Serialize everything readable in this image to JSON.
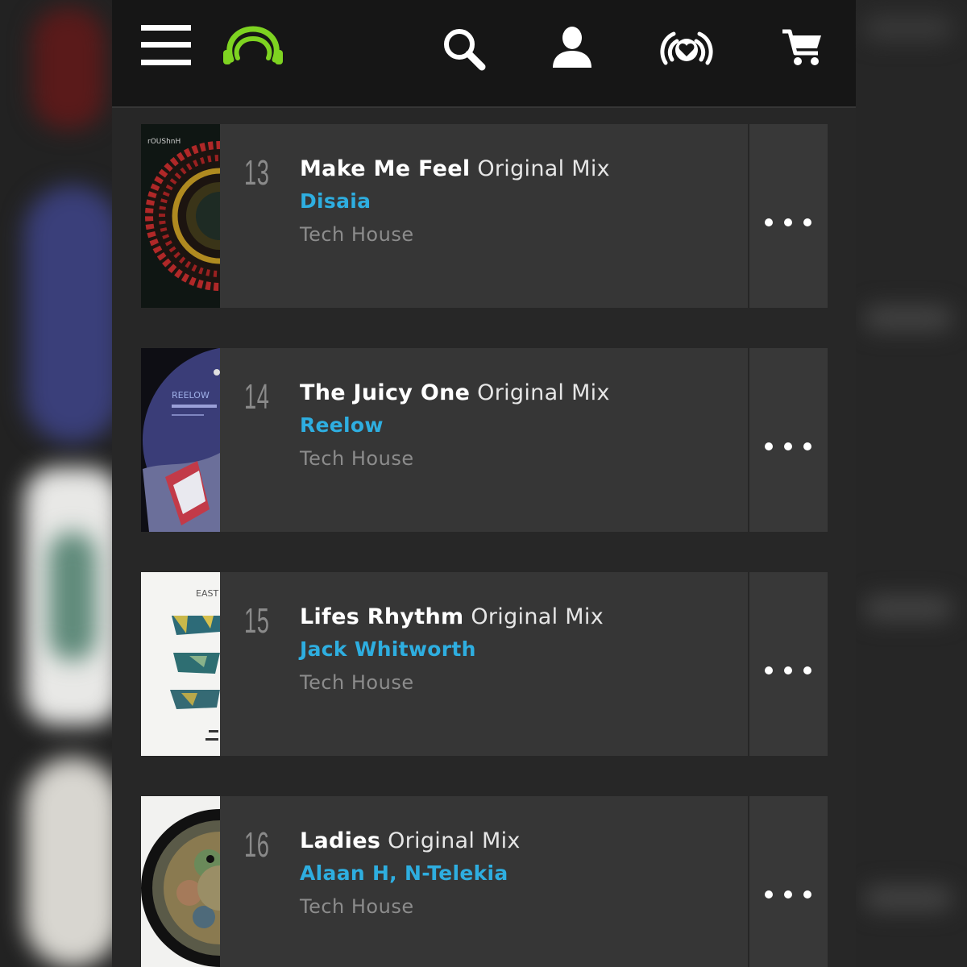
{
  "header": {
    "menu_icon": "hamburger-menu-icon",
    "logo_icon": "beatport-headphones-logo",
    "search_icon": "search-icon",
    "account_icon": "user-icon",
    "listen_icon": "heart-broadcast-icon",
    "cart_icon": "cart-icon",
    "logo_color": "#7ed321"
  },
  "colors": {
    "artist": "#2eaee0",
    "row_bg": "#363636",
    "header_bg": "#161616"
  },
  "tracks": [
    {
      "position": "13",
      "title": "Make Me Feel",
      "mix": "Original Mix",
      "artist": "Disaia",
      "genre": "Tech House",
      "more_icon": "more-options-icon"
    },
    {
      "position": "14",
      "title": "The Juicy One",
      "mix": "Original Mix",
      "artist": "Reelow",
      "genre": "Tech House",
      "more_icon": "more-options-icon"
    },
    {
      "position": "15",
      "title": "Lifes Rhythm",
      "mix": "Original Mix",
      "artist": "Jack Whitworth",
      "genre": "Tech House",
      "more_icon": "more-options-icon"
    },
    {
      "position": "16",
      "title": "Ladies",
      "mix": "Original Mix",
      "artist": "Alaan H, N-Telekia",
      "genre": "Tech House",
      "more_icon": "more-options-icon"
    }
  ],
  "artwork_text": {
    "track13": "rOUShnH",
    "track14": "REELOW",
    "track15": "EAST"
  }
}
